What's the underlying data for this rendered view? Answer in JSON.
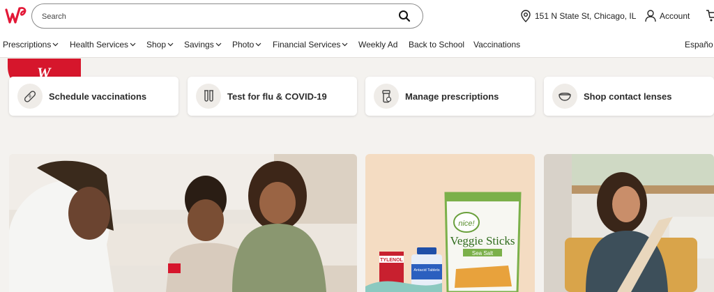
{
  "header": {
    "search_placeholder": "Search",
    "location": "151 N State St, Chicago, IL",
    "account_label": "Account"
  },
  "nav": [
    {
      "label": "Prescriptions",
      "dropdown": true
    },
    {
      "label": "Health Services",
      "dropdown": true
    },
    {
      "label": "Shop",
      "dropdown": true
    },
    {
      "label": "Savings",
      "dropdown": true
    },
    {
      "label": "Photo",
      "dropdown": true
    },
    {
      "label": "Financial Services",
      "dropdown": true
    },
    {
      "label": "Weekly Ad",
      "dropdown": false
    },
    {
      "label": "Back to School",
      "dropdown": false
    },
    {
      "label": "Vaccinations",
      "dropdown": false
    },
    {
      "label": "Españo",
      "dropdown": false
    }
  ],
  "quick_actions": [
    {
      "label": "Schedule vaccinations",
      "icon": "bandage-icon"
    },
    {
      "label": "Test for flu & COVID-19",
      "icon": "test-tubes-icon"
    },
    {
      "label": "Manage prescriptions",
      "icon": "pill-bottle-icon"
    },
    {
      "label": "Shop contact lenses",
      "icon": "contact-lens-icon"
    }
  ],
  "promo_peek": {
    "text": "W"
  },
  "images": [
    {
      "name": "pharmacist-vaccinating-child-image"
    },
    {
      "name": "otc-products-image",
      "labels": {
        "tylenol": "TYLENOL",
        "antacid": "Antacid Tablets",
        "veggie": "Veggie Sticks",
        "veggie_flavor": "Sea Salt",
        "veggie_brand": "nice!"
      }
    },
    {
      "name": "woman-with-package-image"
    }
  ],
  "colors": {
    "brand_red": "#e31837",
    "card_bg": "#ffffff",
    "page_bg": "#f4f2ef"
  }
}
